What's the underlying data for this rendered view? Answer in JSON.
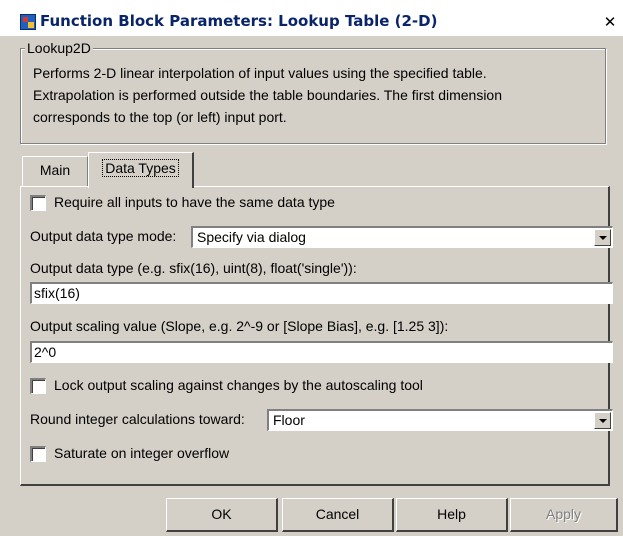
{
  "window": {
    "title": "Function Block Parameters: Lookup Table (2-D)",
    "close_glyph": "✕"
  },
  "group": {
    "legend": "Lookup2D",
    "description": [
      "Performs 2-D linear interpolation of input values using the specified table.",
      "Extrapolation is performed outside the table boundaries.  The first dimension",
      "corresponds to the top (or left) input port."
    ]
  },
  "tabs": [
    {
      "label": "Main",
      "selected": false
    },
    {
      "label": "Data Types",
      "selected": true
    }
  ],
  "form": {
    "require_same_type": {
      "label": "Require all inputs to have the same data type",
      "checked": false
    },
    "output_mode": {
      "label": "Output data type mode:",
      "value": "Specify via dialog"
    },
    "output_type": {
      "label": "Output data type (e.g. sfix(16), uint(8), float('single')):",
      "value": "sfix(16)"
    },
    "output_scaling": {
      "label": "Output scaling value (Slope, e.g. 2^-9 or [Slope Bias], e.g. [1.25 3]):",
      "value": "2^0"
    },
    "lock_scaling": {
      "label": "Lock output scaling against changes by the autoscaling tool",
      "checked": false
    },
    "round_toward": {
      "label": "Round integer calculations toward:",
      "value": "Floor"
    },
    "saturate": {
      "label": "Saturate on integer overflow",
      "checked": false
    }
  },
  "buttons": {
    "ok": "OK",
    "cancel": "Cancel",
    "help": "Help",
    "apply": "Apply"
  },
  "icons": {
    "app": "simulink-block-icon",
    "close": "close-icon",
    "dropdown": "chevron-down-icon"
  }
}
